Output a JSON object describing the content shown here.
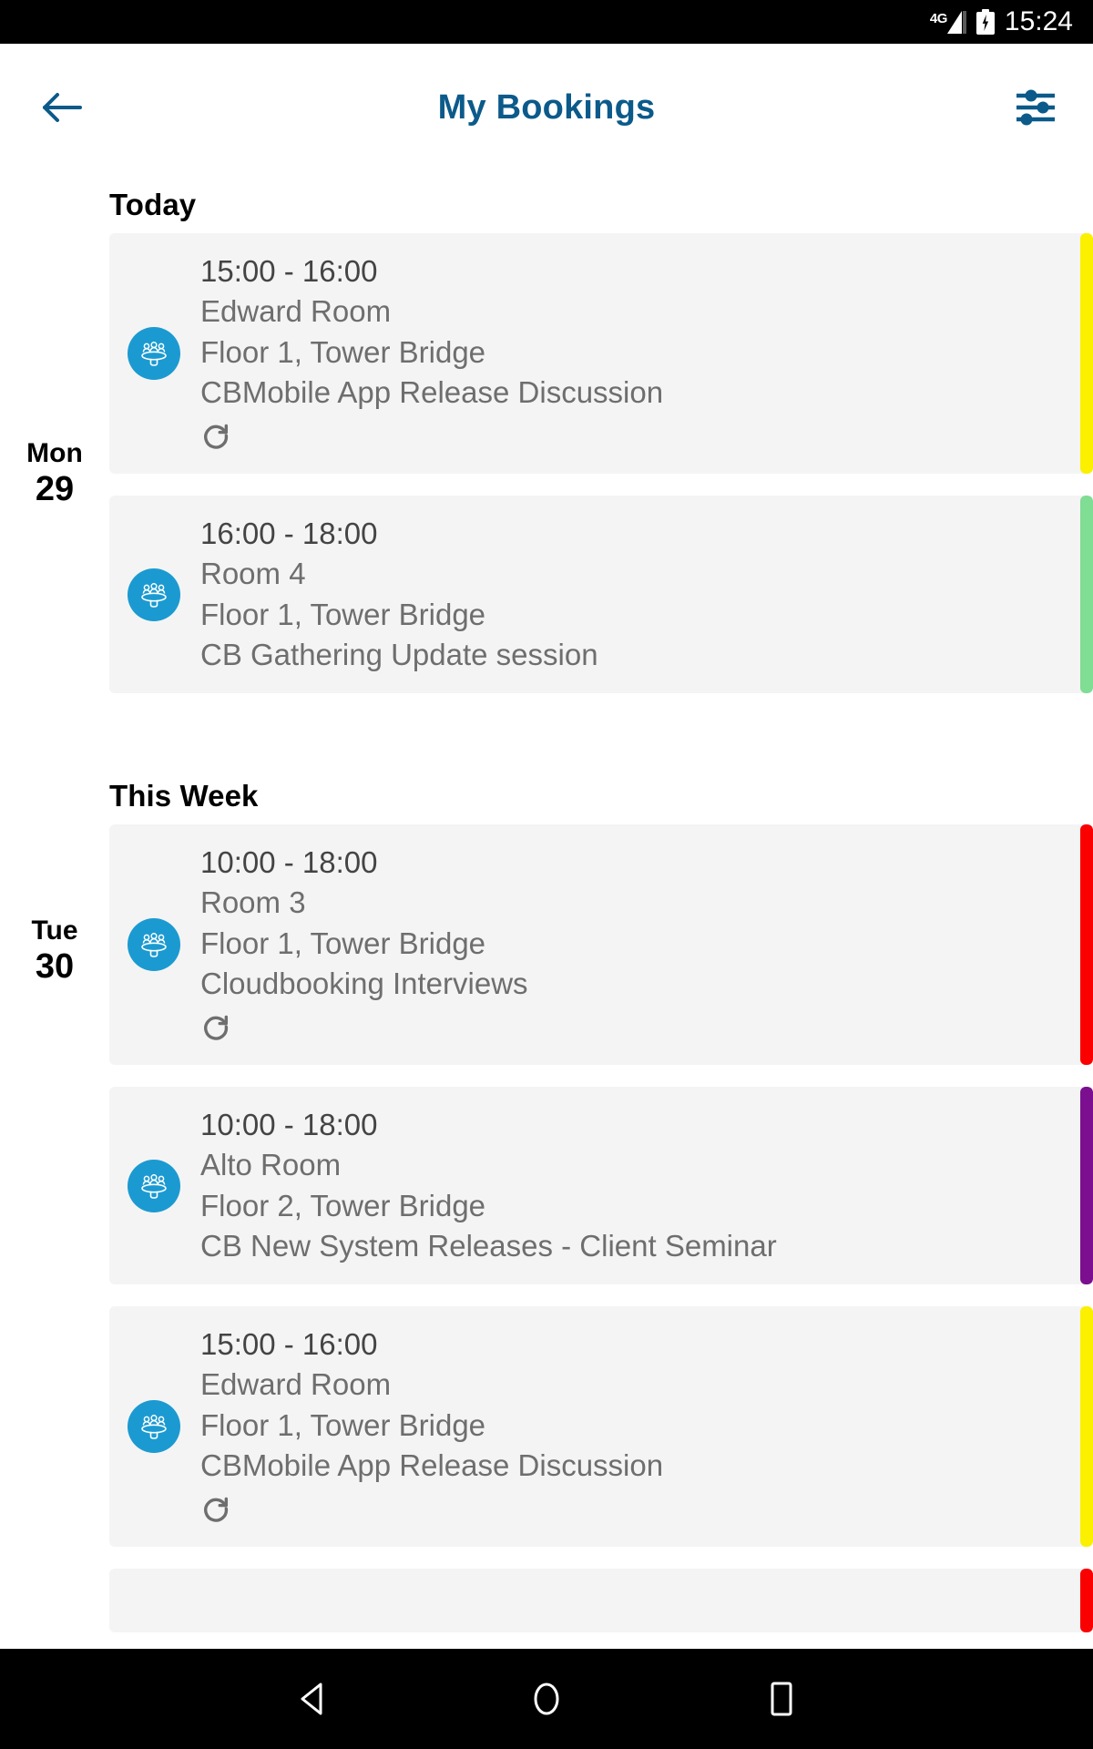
{
  "status_bar": {
    "network_label": "4G",
    "time": "15:24",
    "battery_icon": "battery-charging-icon",
    "signal_icon": "signal-bars-icon"
  },
  "app_bar": {
    "back_icon": "arrow-left-icon",
    "title": "My Bookings",
    "filter_icon": "filter-sliders-icon",
    "title_color": "#0b5a8a"
  },
  "sections": [
    {
      "title": "Today",
      "days": [
        {
          "day_of_week": "Mon",
          "day_number": "29",
          "bookings": [
            {
              "time": "15:00 - 16:00",
              "room": "Edward Room",
              "location": "Floor 1, Tower Bridge",
              "description": "CBMobile App Release Discussion",
              "recurring": true,
              "recurring_icon": "refresh-recurring-icon",
              "room_icon": "meeting-room-icon",
              "stripe_color": "#fbf000"
            },
            {
              "time": "16:00 - 18:00",
              "room": "Room 4",
              "location": "Floor 1, Tower Bridge",
              "description": "CB Gathering Update session",
              "recurring": false,
              "recurring_icon": "",
              "room_icon": "meeting-room-icon",
              "stripe_color": "#7fdd94"
            }
          ]
        }
      ]
    },
    {
      "title": "This Week",
      "days": [
        {
          "day_of_week": "Tue",
          "day_number": "30",
          "bookings": [
            {
              "time": "10:00 - 18:00",
              "room": "Room 3",
              "location": "Floor 1, Tower Bridge",
              "description": "Cloudbooking Interviews",
              "recurring": true,
              "recurring_icon": "refresh-recurring-icon",
              "room_icon": "meeting-room-icon",
              "stripe_color": "#fb0000"
            },
            {
              "time": "10:00 - 18:00",
              "room": "Alto Room",
              "location": "Floor 2, Tower Bridge",
              "description": "CB New System Releases - Client Seminar",
              "recurring": false,
              "recurring_icon": "",
              "room_icon": "meeting-room-icon",
              "stripe_color": "#7b0f8f"
            },
            {
              "time": "15:00 - 16:00",
              "room": "Edward Room",
              "location": "Floor 1, Tower Bridge",
              "description": "CBMobile App Release Discussion",
              "recurring": true,
              "recurring_icon": "refresh-recurring-icon",
              "room_icon": "meeting-room-icon",
              "stripe_color": "#fbf000"
            }
          ]
        }
      ]
    }
  ],
  "partial_card": {
    "stripe_color": "#fb0000"
  },
  "nav_bar": {
    "back_icon": "nav-back-triangle-icon",
    "home_icon": "nav-home-circle-icon",
    "recents_icon": "nav-recents-square-icon"
  },
  "theme": {
    "icon_circle_color": "#1b9ad1",
    "card_background": "#f4f4f4",
    "text_primary": "#444444",
    "text_secondary": "#6e6e6e"
  }
}
